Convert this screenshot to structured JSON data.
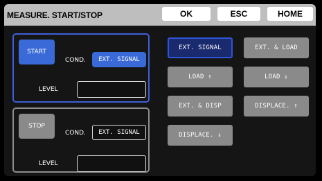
{
  "header": {
    "title": "MEASURE. START/STOP",
    "ok_label": "OK",
    "esc_label": "ESC",
    "home_label": "HOME"
  },
  "start_panel": {
    "mode_label": "START",
    "cond_label": "COND.",
    "cond_value": "EXT. SIGNAL",
    "level_label": "LEVEL",
    "level_value": ""
  },
  "stop_panel": {
    "mode_label": "STOP",
    "cond_label": "COND.",
    "cond_value": "EXT. SIGNAL",
    "level_label": "LEVEL",
    "level_value": ""
  },
  "options": [
    {
      "label": "EXT. SIGNAL",
      "selected": true
    },
    {
      "label": "EXT. & LOAD",
      "selected": false
    },
    {
      "label": "LOAD ↑",
      "selected": false
    },
    {
      "label": "LOAD ↓",
      "selected": false
    },
    {
      "label": "EXT. & DISP",
      "selected": false
    },
    {
      "label": "DISPLACE. ↑",
      "selected": false
    },
    {
      "label": "DISPLACE. ↓",
      "selected": false
    }
  ],
  "colors": {
    "accent_blue": "#3a6ad8",
    "selected_option_bg": "#1a2a6e",
    "button_gray": "#8a8a8a",
    "title_bar": "#bebebe"
  }
}
